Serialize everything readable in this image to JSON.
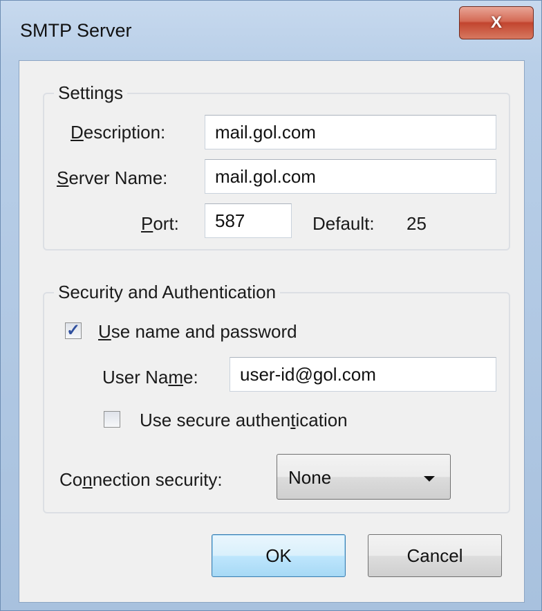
{
  "window": {
    "title": "SMTP Server",
    "close_label": "X"
  },
  "settings": {
    "legend": "Settings",
    "description": {
      "label_pre": "",
      "label_key": "D",
      "label_post": "escription:",
      "value": "mail.gol.com"
    },
    "server_name": {
      "label_pre": "",
      "label_key": "S",
      "label_post": "erver Name:",
      "value": "mail.gol.com"
    },
    "port": {
      "label_pre": "",
      "label_key": "P",
      "label_post": "ort:",
      "value": "587",
      "default_label": "Default:",
      "default_value": "25"
    }
  },
  "security": {
    "legend": "Security and Authentication",
    "use_name_password": {
      "label_pre": "",
      "label_key": "U",
      "label_post": "se name and password",
      "checked": true
    },
    "user_name": {
      "label_pre": "User Na",
      "label_key": "m",
      "label_post": "e:",
      "value": "user-id@gol.com"
    },
    "secure_auth": {
      "label_pre": "Use secure authen",
      "label_key": "t",
      "label_post": "ication",
      "checked": false
    },
    "connection_security": {
      "label_pre": "Co",
      "label_key": "n",
      "label_post": "nection security:",
      "selected": "None"
    }
  },
  "buttons": {
    "ok": "OK",
    "cancel": "Cancel"
  }
}
